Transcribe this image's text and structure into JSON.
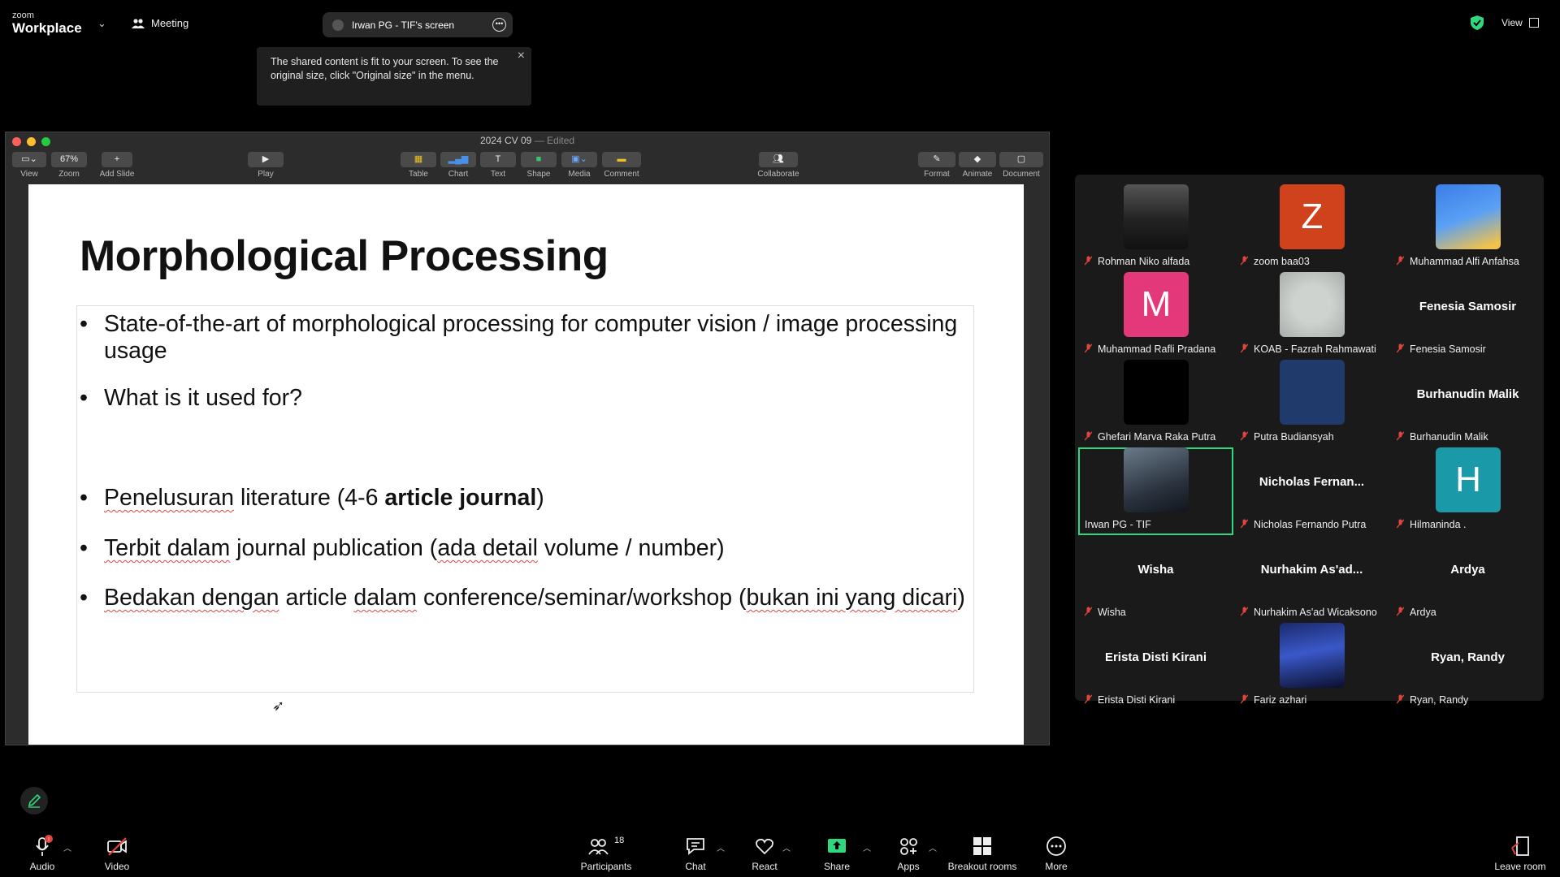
{
  "topbar": {
    "logo_small": "zoom",
    "logo_big": "Workplace",
    "meeting_label": "Meeting",
    "share_pill_label": "Irwan PG - TIF's screen",
    "tooltip_text": "The shared content is fit to your screen. To see the original size, click \"Original size\" in the menu.",
    "view_label": "View"
  },
  "keynote": {
    "window_title": "2024 CV 09",
    "edited": "— Edited",
    "toolbar": {
      "view": "View",
      "zoom_value": "67%",
      "zoom": "Zoom",
      "add_slide": "Add Slide",
      "play": "Play",
      "table": "Table",
      "chart": "Chart",
      "text": "Text",
      "shape": "Shape",
      "media": "Media",
      "comment": "Comment",
      "collaborate": "Collaborate",
      "format": "Format",
      "animate": "Animate",
      "document": "Document"
    },
    "slide": {
      "title": "Morphological Processing",
      "bullet1": "State-of-the-art of morphological processing for computer vision / image processing usage",
      "bullet2": "What is it used for?",
      "bullet3_a": "Penelusuran",
      "bullet3_b": " literature (4-6 ",
      "bullet3_bold": "article journal",
      "bullet3_c": ")",
      "bullet4_a": "Terbit dalam",
      "bullet4_b": " journal publication (",
      "bullet4_c": "ada detail",
      "bullet4_d": " volume / number)",
      "bullet5_a": "Bedakan dengan",
      "bullet5_b": " article ",
      "bullet5_c": "dalam",
      "bullet5_d": " conference/seminar/workshop (",
      "bullet5_e": "bukan ini yang dicari",
      "bullet5_f": ")"
    }
  },
  "participants": [
    {
      "name": "Rohman Niko alfada",
      "kind": "photo-dark"
    },
    {
      "name": "zoom baa03",
      "kind": "letter",
      "letter": "Z",
      "color": "#d0421b"
    },
    {
      "name": "Muhammad Alfi Anfahsa",
      "kind": "photo-blue"
    },
    {
      "name": "Muhammad Rafli Pradana",
      "kind": "letter",
      "letter": "M",
      "color": "#e3387a"
    },
    {
      "name": "KOAB - Fazrah Rahmawati",
      "kind": "photo-grey"
    },
    {
      "name": "Fenesia Samosir",
      "kind": "text",
      "big": "Fenesia Samosir"
    },
    {
      "name": "Ghefari Marva Raka Putra",
      "kind": "photo-black"
    },
    {
      "name": "Putra Budiansyah",
      "kind": "photo-navy"
    },
    {
      "name": "Burhanudin Malik",
      "kind": "text",
      "big": "Burhanudin Malik"
    },
    {
      "name": "Irwan PG - TIF",
      "kind": "photo-piano"
    },
    {
      "name": "Nicholas Fernando Putra",
      "kind": "text",
      "big": "Nicholas  Fernan..."
    },
    {
      "name": "Hilmaninda .",
      "kind": "letter",
      "letter": "H",
      "color": "#1a9aa8"
    },
    {
      "name": "Wisha",
      "kind": "text",
      "big": "Wisha"
    },
    {
      "name": "Nurhakim As'ad Wicaksono",
      "kind": "text",
      "big": "Nurhakim  As'ad..."
    },
    {
      "name": "Ardya",
      "kind": "text",
      "big": "Ardya"
    },
    {
      "name": "Erista Disti Kirani",
      "kind": "text",
      "big": "Erista Disti Kirani"
    },
    {
      "name": "Fariz azhari",
      "kind": "photo-city"
    },
    {
      "name": "Ryan, Randy",
      "kind": "text",
      "big": "Ryan, Randy"
    }
  ],
  "bottombar": {
    "audio": "Audio",
    "video": "Video",
    "participants": "Participants",
    "participants_count": "18",
    "chat": "Chat",
    "react": "React",
    "share": "Share",
    "apps": "Apps",
    "breakout": "Breakout rooms",
    "more": "More",
    "leave": "Leave room"
  },
  "colors": {
    "share_green": "#2fd87d",
    "mute_red": "#e0443a"
  }
}
